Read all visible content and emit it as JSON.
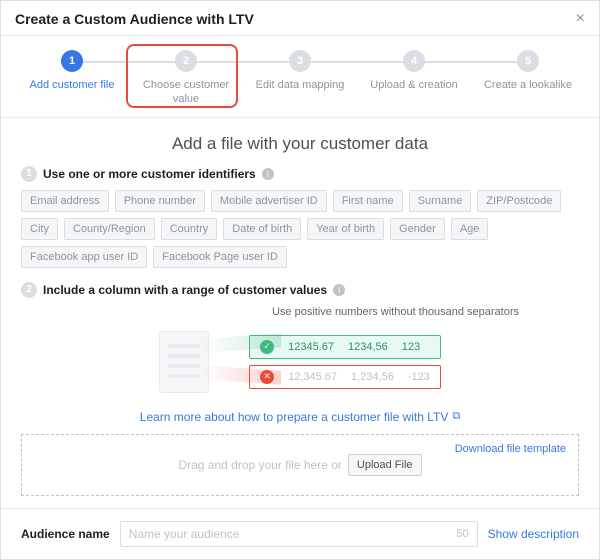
{
  "header": {
    "title": "Create a Custom Audience with LTV"
  },
  "steps": [
    {
      "num": "1",
      "label": "Add customer file"
    },
    {
      "num": "2",
      "label": "Choose customer value"
    },
    {
      "num": "3",
      "label": "Edit data mapping"
    },
    {
      "num": "4",
      "label": "Upload & creation"
    },
    {
      "num": "5",
      "label": "Create a lookalike"
    }
  ],
  "body": {
    "title": "Add a file with your customer data",
    "section1": {
      "num": "1",
      "label": "Use one or more customer identifiers"
    },
    "identifiers": [
      "Email address",
      "Phone number",
      "Mobile advertiser ID",
      "First name",
      "Surname",
      "ZIP/Postcode",
      "City",
      "County/Region",
      "Country",
      "Date of birth",
      "Year of birth",
      "Gender",
      "Age",
      "Facebook app user ID",
      "Facebook Page user ID"
    ],
    "section2": {
      "num": "2",
      "label": "Include a column with a range of customer values"
    },
    "hint": "Use positive numbers without thousand separators",
    "good": [
      "12345.67",
      "1234,56",
      "123"
    ],
    "bad": [
      "12,345.67",
      "1,234,56",
      "-123"
    ],
    "learn": "Learn more about how to prepare a customer file with LTV",
    "dropzone": {
      "download": "Download file template",
      "drag": "Drag and drop your file here or",
      "upload": "Upload File"
    }
  },
  "footer": {
    "label": "Audience name",
    "placeholder": "Name your audience",
    "counter": "50",
    "showdesc": "Show description"
  }
}
